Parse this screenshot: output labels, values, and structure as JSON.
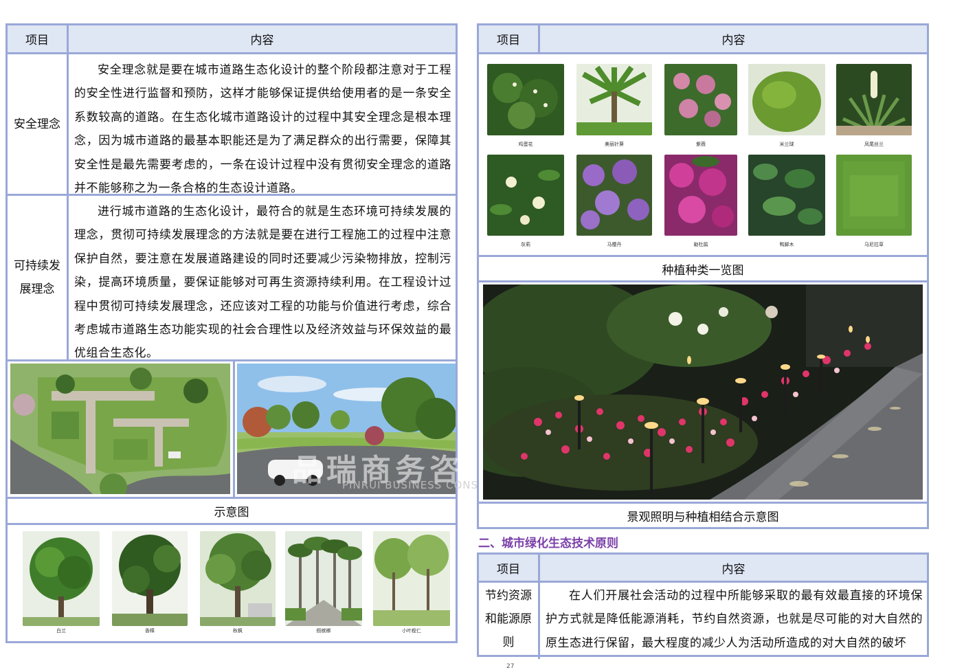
{
  "left_table": {
    "header": {
      "item": "项目",
      "content": "内容"
    },
    "rows": [
      {
        "label": "安全理念",
        "text": "安全理念就是要在城市道路生态化设计的整个阶段都注意对于工程的安全性进行监督和预防，这样才能够保证提供给使用者的是一条安全系数较高的道路。在生态化城市道路设计的过程中其安全理念是根本理念，因为城市道路的最基本职能还是为了满足群众的出行需要，保障其安全性是最先需要考虑的，一条在设计过程中没有贯彻安全理念的道路并不能够称之为一条合格的生态设计道路。"
      },
      {
        "label": "可持续发展理念",
        "text": "进行城市道路的生态化设计，最符合的就是生态环境可持续发展的理念，贯彻可持续发展理念的方法就是要在进行工程施工的过程中注意保护自然，要注意在发展道路建设的同时还要减少污染物排放，控制污染，提高环境质量，要保证能够对可再生资源持续利用。在工程设计过程中贯彻可持续发展理念，还应该对工程的功能与价值进行考虑，综合考虑城市道路生态功能实现的社会合理性以及经济效益与环保效益的最优组合生态化。"
      }
    ],
    "diagram_caption": "示意图",
    "trees": [
      "白兰",
      "香樟",
      "秋枫",
      "假槟榔",
      "小叶榄仁"
    ]
  },
  "right_table": {
    "header": {
      "item": "项目",
      "content": "内容"
    },
    "plants_row1": [
      "鸡蛋花",
      "美丽针葵",
      "紫薇",
      "米兰球",
      "凤尾丝兰"
    ],
    "plants_row2": [
      "灰莉",
      "马樱丹",
      "勒杜鹃",
      "鸭脚木",
      "马尼拉草"
    ],
    "plant_caption": "种植种类一览图",
    "lighting_caption": "景观照明与种植相结合示意图"
  },
  "section_heading": "二、城市绿化生态技术原则",
  "bottom_table": {
    "header": {
      "item": "项目",
      "content": "内容"
    },
    "row": {
      "label": "节约资源和能源原则",
      "text": "在人们开展社会活动的过程中所能够采取的最有效最直接的环境保护方式就是降低能源消耗，节约自然资源，也就是尽可能的对大自然的原生态进行保留，最大程度的减少人为活动所造成的对大自然的破坏"
    }
  },
  "watermark": {
    "cn": "品瑞商务咨询",
    "en": "PINRUI BUSINESS CONSULTING"
  },
  "page_number": "27",
  "colors": {
    "border": "#9aa8d8",
    "header_bg": "#dfe6f4",
    "heading": "#7a3fa8"
  }
}
